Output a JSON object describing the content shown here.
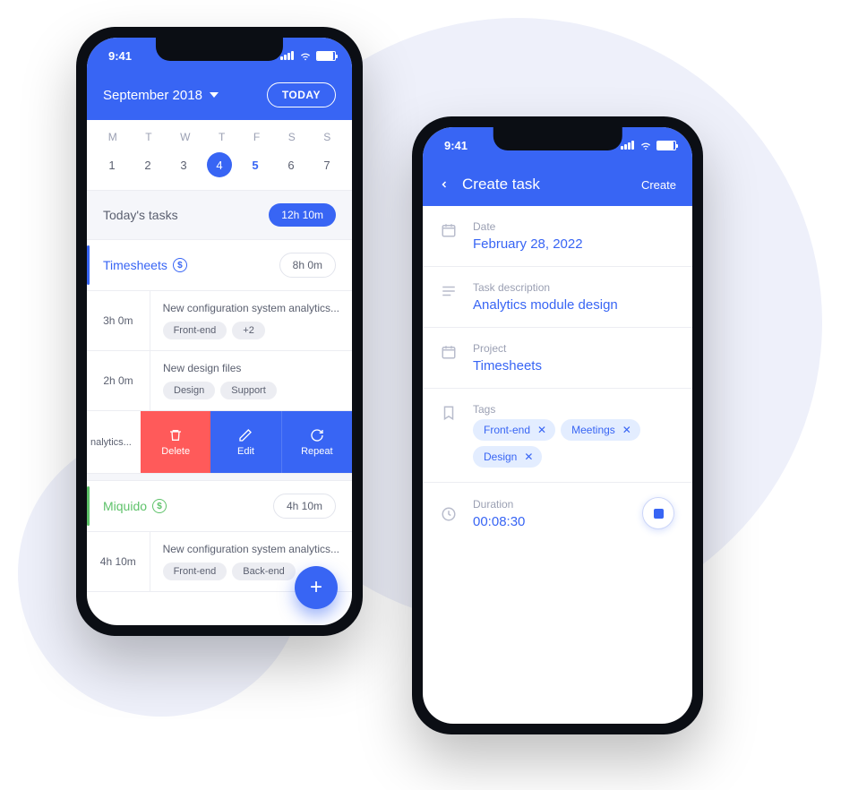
{
  "status": {
    "time": "9:41"
  },
  "phone1": {
    "header": {
      "month": "September 2018",
      "today_btn": "TODAY"
    },
    "weekdays": [
      "M",
      "T",
      "W",
      "T",
      "F",
      "S",
      "S"
    ],
    "days": [
      "1",
      "2",
      "3",
      "4",
      "5",
      "6",
      "7"
    ],
    "todays_tasks": {
      "label": "Today's tasks",
      "duration": "12h 10m"
    },
    "projects": [
      {
        "name": "Timesheets",
        "color": "blue",
        "total": "8h 0m",
        "tasks": [
          {
            "time": "3h 0m",
            "title": "New configuration system analytics...",
            "tags": [
              "Front-end",
              "+2"
            ]
          },
          {
            "time": "2h 0m",
            "title": "New design files",
            "tags": [
              "Design",
              "Support"
            ]
          }
        ]
      },
      {
        "name": "Miquido",
        "color": "green",
        "total": "4h 10m",
        "tasks": [
          {
            "time": "4h 10m",
            "title": "New configuration system analytics...",
            "tags": [
              "Front-end",
              "Back-end"
            ]
          }
        ]
      }
    ],
    "swipe": {
      "peek": "nalytics...",
      "delete": "Delete",
      "edit": "Edit",
      "repeat": "Repeat"
    }
  },
  "phone2": {
    "header": {
      "title": "Create task",
      "action": "Create"
    },
    "fields": {
      "date": {
        "label": "Date",
        "value": "February 28, 2022"
      },
      "description": {
        "label": "Task description",
        "value": "Analytics module design"
      },
      "project": {
        "label": "Project",
        "value": "Timesheets"
      },
      "tags": {
        "label": "Tags",
        "values": [
          "Front-end",
          "Meetings",
          "Design"
        ]
      },
      "duration": {
        "label": "Duration",
        "value": "00:08:30"
      }
    }
  }
}
